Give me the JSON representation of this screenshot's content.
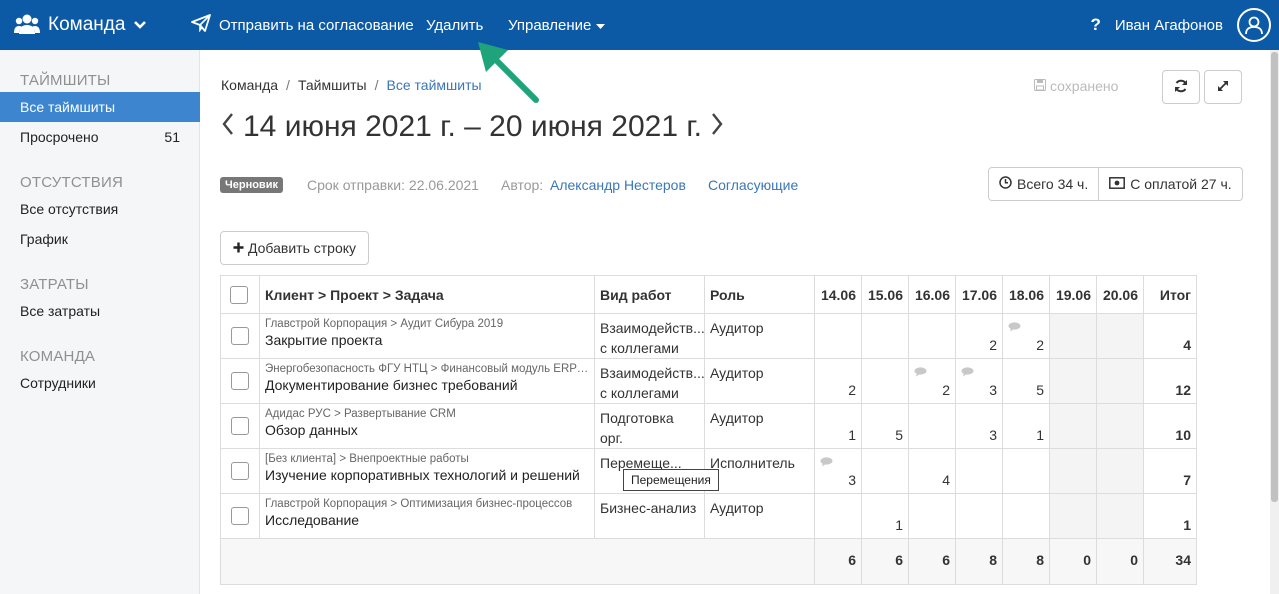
{
  "topbar": {
    "brand": "Команда",
    "nav": [
      "Отправить на согласование",
      "Удалить",
      "Управление"
    ],
    "help": "?",
    "user": "Иван Агафонов"
  },
  "sidebar": {
    "sections": [
      {
        "title": "ТАЙМШИТЫ",
        "items": [
          {
            "label": "Все таймшиты",
            "active": true
          },
          {
            "label": "Просрочено",
            "count": "51"
          }
        ]
      },
      {
        "title": "ОТСУТСТВИЯ",
        "items": [
          {
            "label": "Все отсутствия"
          },
          {
            "label": "График"
          }
        ]
      },
      {
        "title": "ЗАТРАТЫ",
        "items": [
          {
            "label": "Все затраты"
          }
        ]
      },
      {
        "title": "КОМАНДА",
        "items": [
          {
            "label": "Сотрудники"
          }
        ]
      }
    ]
  },
  "breadcrumb": [
    "Команда",
    "Таймшиты",
    "Все таймшиты"
  ],
  "saved_label": "сохранено",
  "period_title": "14 июня 2021 г. – 20 июня 2021 г.",
  "status_badge": "Черновик",
  "deadline": "Срок отправки: 22.06.2021",
  "author_label": "Автор:",
  "author_name": "Александр Нестеров",
  "approvers_link": "Согласующие",
  "totals": {
    "all": "Всего 34 ч.",
    "billable": "С оплатой 27 ч."
  },
  "add_row_label": "Добавить строку",
  "table": {
    "headers": {
      "task": "Клиент > Проект > Задача",
      "work_type": "Вид работ",
      "role": "Роль",
      "days": [
        "14.06",
        "15.06",
        "16.06",
        "17.06",
        "18.06",
        "19.06",
        "20.06"
      ],
      "total": "Итог"
    },
    "rows": [
      {
        "path": "Главстрой Корпорация > Аудит Сибура 2019",
        "task": "Закрытие проекта",
        "work_type": "Взаимодейств... с коллегами",
        "work_type_1": "Взаимодейств...",
        "work_type_2": "с коллегами",
        "role": "Аудитор",
        "days": [
          "",
          "",
          "",
          "2",
          "2",
          "",
          ""
        ],
        "total": "4"
      },
      {
        "path": "Энергобезопасность ФГУ НТЦ > Финансовый модуль ERP -...",
        "task": "Документирование бизнес требований",
        "work_type_1": "Взаимодейств...",
        "work_type_2": "с коллегами",
        "role": "Аудитор",
        "days": [
          "2",
          "",
          "2",
          "3",
          "5",
          "",
          ""
        ],
        "total": "12"
      },
      {
        "path": "Адидас РУС > Развертывание CRM",
        "task": "Обзор данных",
        "work_type_1": "Подготовка",
        "work_type_2": "орг.",
        "role": "Аудитор",
        "days": [
          "1",
          "5",
          "",
          "3",
          "1",
          "",
          ""
        ],
        "total": "10"
      },
      {
        "path": "[Без клиента] > Внепроектные работы",
        "task": "Изучение корпоративных технологий и решений",
        "work_type_1": "Перемеще...",
        "work_type_2": "",
        "role": "Исполнитель",
        "days": [
          "3",
          "",
          "4",
          "",
          "",
          "",
          ""
        ],
        "total": "7"
      },
      {
        "path": "Главстрой Корпорация > Оптимизация бизнес-процессов",
        "task": "Исследование",
        "work_type_1": "Бизнес-анализ",
        "work_type_2": "",
        "role": "Аудитор",
        "days": [
          "",
          "1",
          "",
          "",
          "",
          "",
          ""
        ],
        "total": "1"
      }
    ],
    "footer": {
      "days": [
        "6",
        "6",
        "6",
        "8",
        "8",
        "0",
        "0"
      ],
      "total": "34"
    }
  },
  "tooltip": "Перемещения",
  "colors": {
    "topbar": "#0c5aa6",
    "active_item": "#3d86cf",
    "link": "#3a77b7",
    "arrow": "#1fa37a"
  }
}
